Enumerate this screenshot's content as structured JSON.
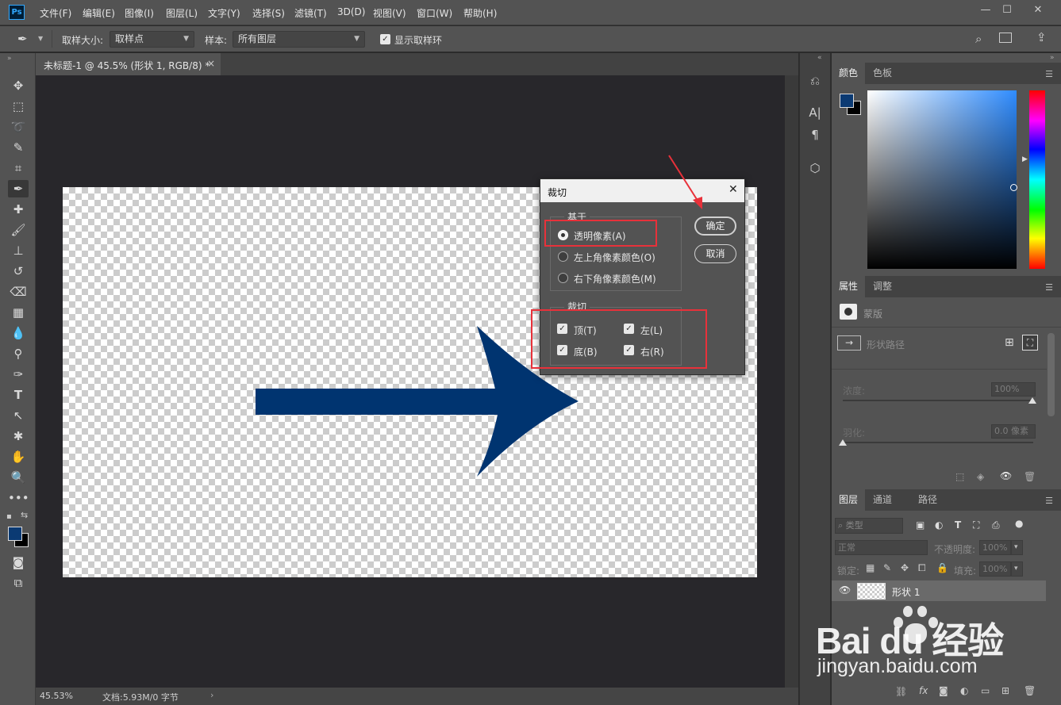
{
  "app": {
    "logo": "Ps",
    "menu": [
      "文件(F)",
      "编辑(E)",
      "图像(I)",
      "图层(L)",
      "文字(Y)",
      "选择(S)",
      "滤镜(T)",
      "3D(D)",
      "视图(V)",
      "窗口(W)",
      "帮助(H)"
    ],
    "window_controls": {
      "minimize": "—",
      "restore": "☐",
      "close": "✕"
    }
  },
  "options_bar": {
    "sample_size_label": "取样大小:",
    "sample_size_value": "取样点",
    "sample_label": "样本:",
    "sample_value": "所有图层",
    "show_ring_label": "显示取样环",
    "show_ring_checked": true
  },
  "document": {
    "tab_title": "未标题-1 @ 45.5% (形状 1, RGB/8) *",
    "close_glyph": "×",
    "zoom": "45.53%",
    "doc_info": "文档:5.93M/0 字节",
    "arrow_color": "#003470"
  },
  "dialog": {
    "title": "裁切",
    "based_on_legend": "基于",
    "based_on_options": [
      {
        "label": "透明像素(A)",
        "selected": true
      },
      {
        "label": "左上角像素颜色(O)",
        "selected": false
      },
      {
        "label": "右下角像素颜色(M)",
        "selected": false
      }
    ],
    "trim_legend": "裁切",
    "trim_options": {
      "top": "顶(T)",
      "left": "左(L)",
      "bottom": "底(B)",
      "right": "右(R)"
    },
    "ok_label": "确定",
    "cancel_label": "取消",
    "close_glyph": "✕",
    "highlight_color": "#e8313a"
  },
  "color_panel": {
    "tabs": [
      "颜色",
      "色板"
    ],
    "foreground": "#0b3a73",
    "background": "#000000"
  },
  "properties_panel": {
    "tabs": [
      "属性",
      "调整"
    ],
    "mask_label": "蒙版",
    "shape_path_label": "形状路径",
    "density_label": "浓度:",
    "density_value": "100%",
    "feather_label": "羽化:",
    "feather_value": "0.0 像素"
  },
  "layers_panel": {
    "tabs": [
      "图层",
      "通道",
      "路径"
    ],
    "filter_kind": "类型",
    "blend_mode": "正常",
    "opacity_label": "不透明度:",
    "opacity_value": "100%",
    "lock_label": "锁定:",
    "fill_label": "填充:",
    "fill_value": "100%",
    "layers": [
      {
        "name": "形状 1",
        "visible": true
      }
    ]
  },
  "watermark": {
    "brand": "Bai du 经验",
    "url": "jingyan.baidu.com"
  }
}
